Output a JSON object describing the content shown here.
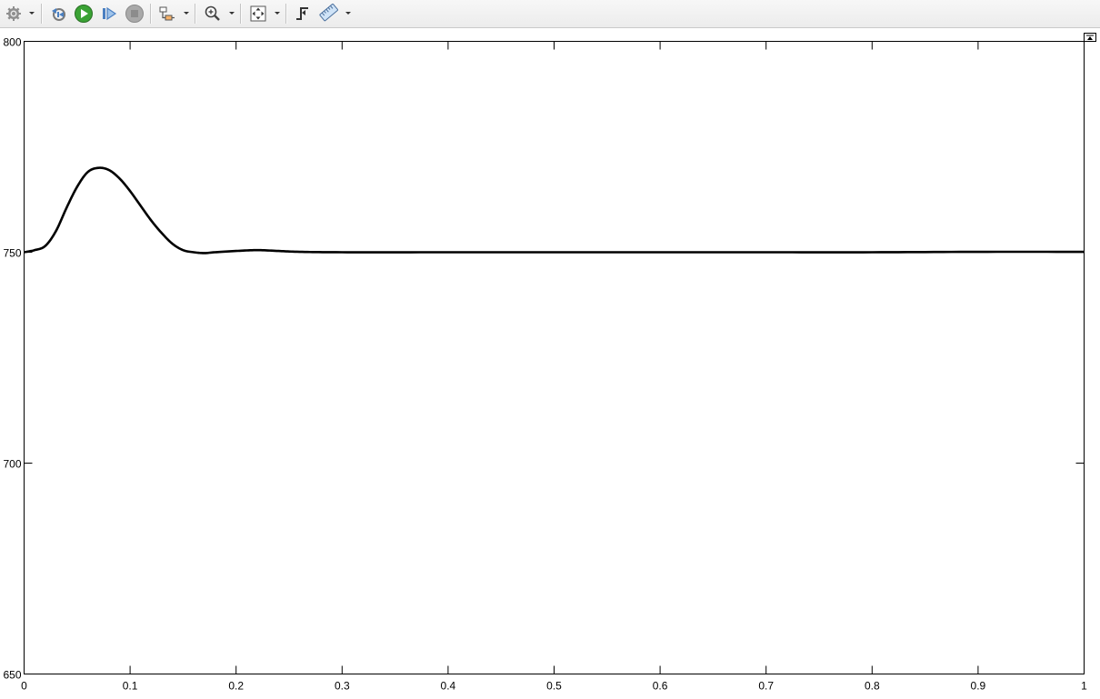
{
  "toolbar": {
    "buttons": [
      {
        "name": "settings",
        "icon": "gear-icon"
      },
      {
        "name": "step-back",
        "icon": "step-back-icon"
      },
      {
        "name": "run",
        "icon": "play-icon"
      },
      {
        "name": "step-forward",
        "icon": "step-forward-icon"
      },
      {
        "name": "stop",
        "icon": "stop-icon"
      },
      {
        "name": "highlight-model",
        "icon": "highlight-icon"
      },
      {
        "name": "zoom",
        "icon": "zoom-in-icon"
      },
      {
        "name": "autoscale",
        "icon": "autoscale-icon"
      },
      {
        "name": "triggers",
        "icon": "trigger-icon"
      },
      {
        "name": "measurements",
        "icon": "ruler-icon"
      }
    ],
    "colors": {
      "play": "#3aa234",
      "step": "#4a7fc1",
      "stop": "#9a9a9a"
    }
  },
  "chart_data": {
    "type": "line",
    "title": "",
    "xlabel": "",
    "ylabel": "",
    "xlim": [
      0,
      1
    ],
    "ylim": [
      650,
      800
    ],
    "x_ticks": [
      "0",
      "0.1",
      "0.2",
      "0.3",
      "0.4",
      "0.5",
      "0.6",
      "0.7",
      "0.8",
      "0.9",
      "1"
    ],
    "y_ticks": [
      "650",
      "700",
      "750",
      "800"
    ],
    "grid": false,
    "line_color": "#000000",
    "series": [
      {
        "x": [
          0,
          0.01,
          0.02,
          0.03,
          0.04,
          0.05,
          0.06,
          0.07,
          0.08,
          0.09,
          0.1,
          0.11,
          0.12,
          0.13,
          0.14,
          0.15,
          0.16,
          0.17,
          0.18,
          0.2,
          0.22,
          0.24,
          0.26,
          0.3,
          0.4,
          0.5,
          0.6,
          0.7,
          0.8,
          0.9,
          1.0
        ],
        "y": [
          750,
          750.5,
          751.5,
          755,
          760.5,
          765.5,
          769,
          770,
          769.5,
          767.5,
          764.5,
          761,
          757.5,
          754.5,
          752,
          750.5,
          750,
          749.8,
          750,
          750.3,
          750.5,
          750.3,
          750.1,
          750,
          750,
          750,
          750,
          750,
          750,
          750.1,
          750.1
        ]
      }
    ]
  }
}
